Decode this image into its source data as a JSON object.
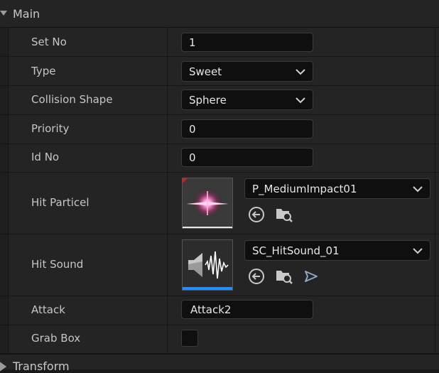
{
  "section": {
    "main": "Main",
    "transform": "Transform"
  },
  "rows": {
    "set_no": {
      "label": "Set No",
      "value": "1"
    },
    "type": {
      "label": "Type",
      "value": "Sweet"
    },
    "collision_shape": {
      "label": "Collision Shape",
      "value": "Sphere"
    },
    "priority": {
      "label": "Priority",
      "value": "0"
    },
    "id_no": {
      "label": "Id No",
      "value": "0"
    },
    "hit_particel": {
      "label": "Hit Particel",
      "asset": "P_MediumImpact01"
    },
    "hit_sound": {
      "label": "Hit Sound",
      "asset": "SC_HitSound_01"
    },
    "attack": {
      "label": "Attack",
      "value": "Attack2"
    },
    "grab_box": {
      "label": "Grab Box",
      "checked": false
    }
  },
  "icons": {
    "expand": "triangle-down-icon",
    "collapse": "triangle-right-icon",
    "use_selected": "arrow-left-circle-icon",
    "browse": "folder-search-icon",
    "play": "play-icon",
    "dropdown": "chevron-down-icon"
  },
  "colors": {
    "particle_accent": "#ff3d8a",
    "sound_accent": "#1e90ff",
    "asset_marker": "#d01c1c"
  }
}
